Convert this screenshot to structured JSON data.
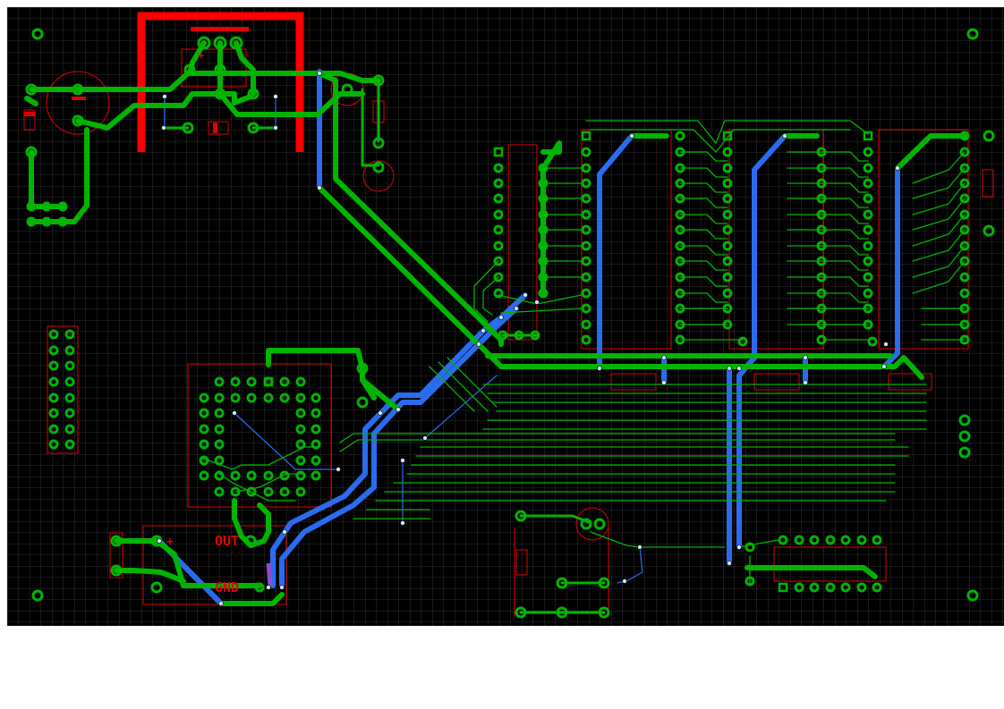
{
  "board": {
    "grid": true,
    "colors": {
      "canvas": "#ffffff",
      "board": "#000000",
      "grid": "#3c3c3c",
      "top_copper": "#00b400",
      "bottom_copper": "#2a6cf0",
      "silkscreen": "#e00000",
      "via": "#cfe8ff"
    },
    "labels": {
      "out": "OUT",
      "gnd": "GND",
      "plus_regulator": "+",
      "plus_output": "+"
    }
  }
}
